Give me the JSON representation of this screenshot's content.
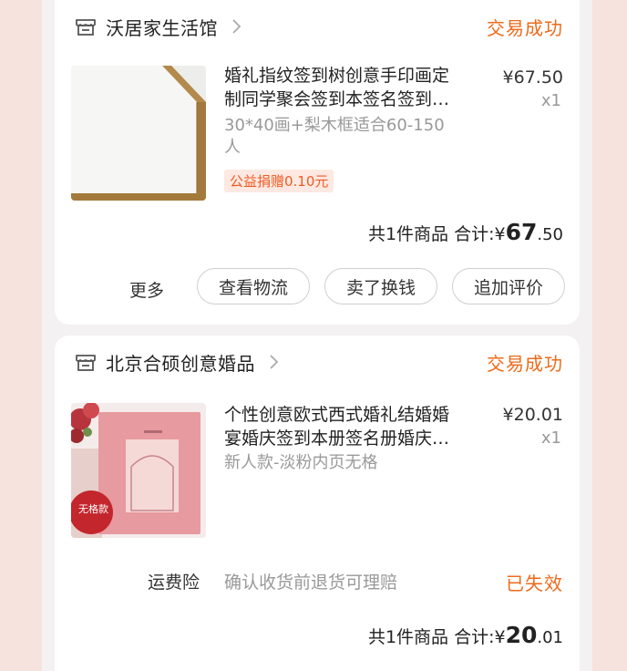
{
  "orders": [
    {
      "shop_name": "沃居家生活馆",
      "status": "交易成功",
      "item": {
        "title_line1": "婚礼指纹签到树创意手印画定",
        "title_line2": "制同学聚会签到本签名签到…",
        "spec_line1": "30*40画+梨木框适合60-150",
        "spec_line2": "人",
        "price": "¥67.50",
        "quantity": "x1",
        "charity_tag": "公益捐赠0.10元"
      },
      "summary": {
        "count_text": "共1件商品 合计:",
        "currency": "¥",
        "total_integer": "67",
        "total_decimal": ".50"
      },
      "actions": {
        "more": "更多",
        "logistics": "查看物流",
        "resell": "卖了换钱",
        "review": "追加评价"
      }
    },
    {
      "shop_name": "北京合硕创意婚品",
      "status": "交易成功",
      "item": {
        "title_line1": "个性创意欧式西式婚礼结婚婚",
        "title_line2": "宴婚庆签到本册签名册婚庆…",
        "spec_line1": "新人款-淡粉内页无格",
        "price": "¥20.01",
        "quantity": "x1",
        "thumb_badge": "无格款"
      },
      "insurance": {
        "label": "运费险",
        "text": "确认收货前退货可理赔",
        "status": "已失效"
      },
      "summary": {
        "count_text": "共1件商品 合计:",
        "currency": "¥",
        "total_integer": "20",
        "total_decimal": ".01"
      }
    }
  ],
  "colors": {
    "accent": "#ee6a1a",
    "page_bg": "#f7e3de",
    "card_bg": "#ffffff"
  }
}
